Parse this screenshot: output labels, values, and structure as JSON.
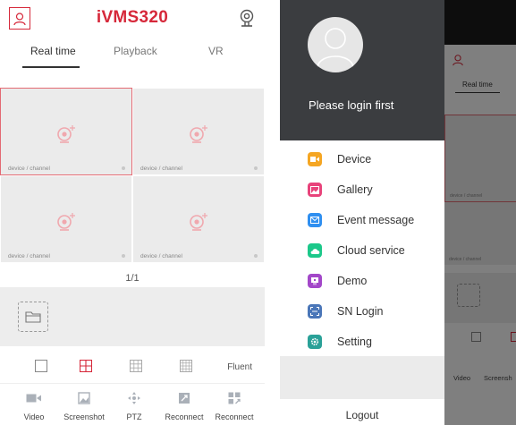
{
  "app": {
    "title": "iVMS320"
  },
  "tabs": [
    {
      "label": "Real time",
      "active": true
    },
    {
      "label": "Playback",
      "active": false
    },
    {
      "label": "VR",
      "active": false
    }
  ],
  "grid": {
    "cells": [
      {
        "label": "device / channel",
        "selected": true
      },
      {
        "label": "device / channel",
        "selected": false
      },
      {
        "label": "device / channel",
        "selected": false
      },
      {
        "label": "device / channel",
        "selected": false
      }
    ],
    "page": "1/1"
  },
  "layout_bar": {
    "quality": "Fluent"
  },
  "actions": [
    {
      "label": "Video",
      "icon": "video-icon"
    },
    {
      "label": "Screenshot",
      "icon": "screenshot-icon"
    },
    {
      "label": "PTZ",
      "icon": "ptz-icon"
    },
    {
      "label": "Reconnect",
      "icon": "reconnect-icon"
    },
    {
      "label": "Reconnect",
      "icon": "reconnect-all-icon"
    }
  ],
  "drawer": {
    "login_prompt": "Please login first",
    "menu": [
      {
        "label": "Device",
        "color": "#f5a623",
        "icon": "device-icon"
      },
      {
        "label": "Gallery",
        "color": "#e8437b",
        "icon": "gallery-icon"
      },
      {
        "label": "Event message",
        "color": "#2f8ff0",
        "icon": "message-icon"
      },
      {
        "label": "Cloud service",
        "color": "#1cc88a",
        "icon": "cloud-icon"
      },
      {
        "label": "Demo",
        "color": "#a347c9",
        "icon": "demo-icon"
      },
      {
        "label": "SN Login",
        "color": "#4a76b8",
        "icon": "scan-icon"
      },
      {
        "label": "Setting",
        "color": "#2aa198",
        "icon": "gear-icon"
      }
    ],
    "logout": "Logout"
  },
  "behind": {
    "tab": "Real time",
    "cell_label": "device / channel",
    "actions": [
      "Video",
      "Screensh"
    ]
  },
  "colors": {
    "accent": "#d6283a",
    "drawer_header": "#3b3d40"
  }
}
